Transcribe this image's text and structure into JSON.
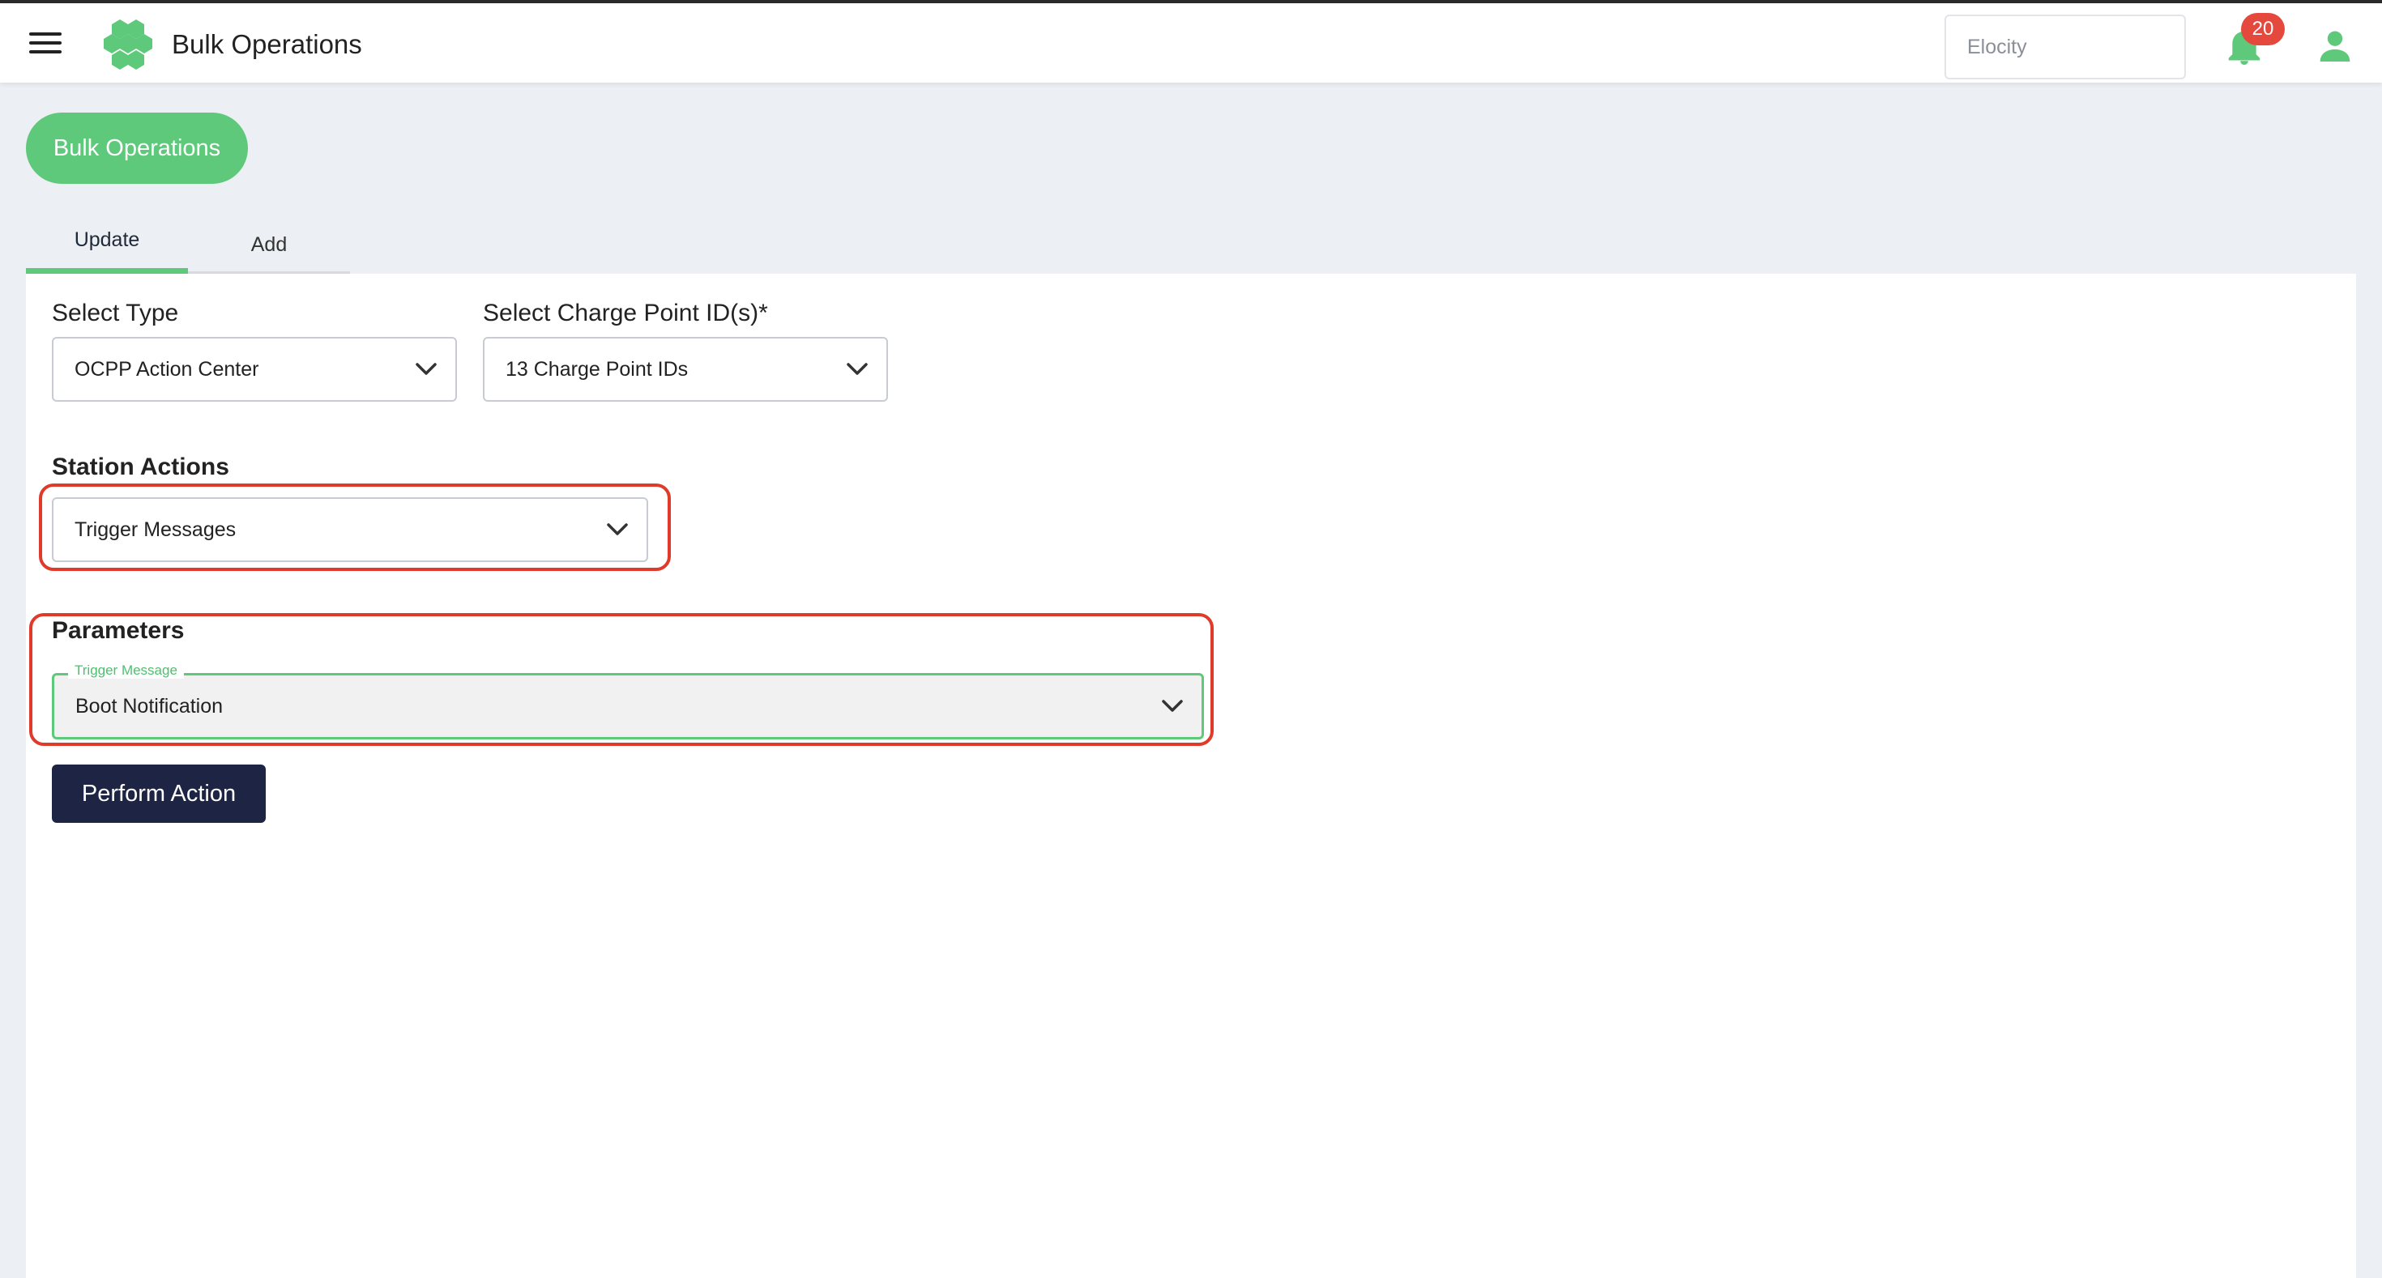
{
  "header": {
    "title": "Bulk Operations",
    "org_placeholder": "Elocity",
    "notification_count": "20",
    "brand_color": "#5ec97a"
  },
  "page": {
    "pill_label": "Bulk Operations",
    "tabs": [
      {
        "label": "Update",
        "active": true
      },
      {
        "label": "Add",
        "active": false
      }
    ]
  },
  "form": {
    "select_type": {
      "label": "Select Type",
      "value": "OCPP Action Center"
    },
    "charge_points": {
      "label": "Select Charge Point ID(s)*",
      "value": "13 Charge Point IDs"
    },
    "station_actions": {
      "label": "Station Actions",
      "value": "Trigger Messages"
    },
    "parameters": {
      "label": "Parameters",
      "field_label": "Trigger Message",
      "value": "Boot Notification"
    },
    "perform_label": "Perform Action"
  },
  "colors": {
    "highlight": "#e03a2b",
    "button_dark": "#1e2544",
    "badge": "#e5483c"
  },
  "icons": [
    "menu-icon",
    "logo-icon",
    "bell-icon",
    "user-icon",
    "chevron-down-icon"
  ]
}
